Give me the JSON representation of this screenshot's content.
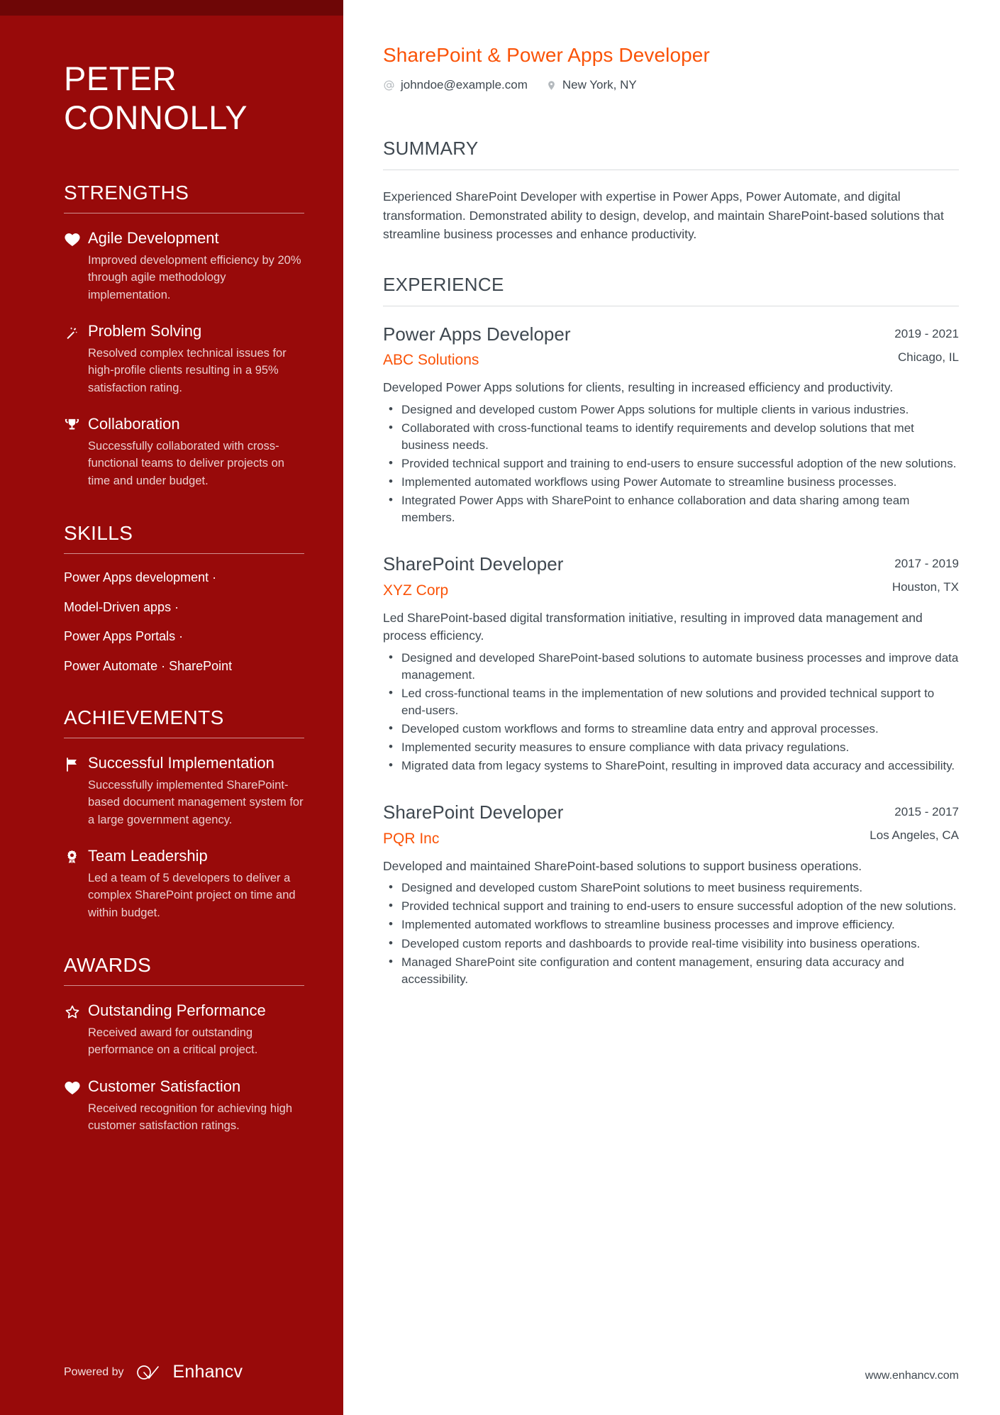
{
  "sidebar": {
    "name": "PETER\nCONNOLLY",
    "name_line1": "PETER",
    "name_line2": "CONNOLLY",
    "sections": [
      {
        "heading": "STRENGTHS",
        "entries": [
          {
            "icon": "heart-icon",
            "title": "Agile Development",
            "desc": "Improved development efficiency by 20% through agile methodology implementation."
          },
          {
            "icon": "magic-wand-icon",
            "title": "Problem Solving",
            "desc": "Resolved complex technical issues for high-profile clients resulting in a 95% satisfaction rating."
          },
          {
            "icon": "trophy-icon",
            "title": "Collaboration",
            "desc": "Successfully collaborated with cross-functional teams to deliver projects on time and under budget."
          }
        ]
      },
      {
        "heading": "ACHIEVEMENTS",
        "entries": [
          {
            "icon": "flag-icon",
            "title": "Successful Implementation",
            "desc": "Successfully implemented SharePoint-based document management system for a large government agency."
          },
          {
            "icon": "award-ribbon-icon",
            "title": "Team Leadership",
            "desc": "Led a team of 5 developers to deliver a complex SharePoint project on time and within budget."
          }
        ]
      },
      {
        "heading": "AWARDS",
        "entries": [
          {
            "icon": "star-icon",
            "title": "Outstanding Performance",
            "desc": "Received award for outstanding performance on a critical project."
          },
          {
            "icon": "heart-icon",
            "title": "Customer Satisfaction",
            "desc": "Received recognition for achieving high customer satisfaction ratings."
          }
        ]
      }
    ],
    "skills": {
      "heading": "SKILLS",
      "lines": [
        "Power Apps development ·",
        "Model-Driven apps ·",
        "Power Apps Portals ·",
        "Power Automate · SharePoint"
      ]
    },
    "footer": {
      "powered_by": "Powered by",
      "brand": "Enhancv"
    }
  },
  "main": {
    "headline": "SharePoint & Power Apps Developer",
    "contact": {
      "email": "johndoe@example.com",
      "email_icon": "at-sign-icon",
      "location": "New York, NY",
      "location_icon": "map-pin-icon"
    },
    "summary": {
      "heading": "SUMMARY",
      "text": "Experienced SharePoint Developer with expertise in Power Apps, Power Automate, and digital transformation. Demonstrated ability to design, develop, and maintain SharePoint-based solutions that streamline business processes and enhance productivity."
    },
    "experience": {
      "heading": "EXPERIENCE",
      "jobs": [
        {
          "role": "Power Apps Developer",
          "company": "ABC Solutions",
          "dates": "2019 - 2021",
          "location": "Chicago, IL",
          "summary": "Developed Power Apps solutions for clients, resulting in increased efficiency and productivity.",
          "bullets": [
            "Designed and developed custom Power Apps solutions for multiple clients in various industries.",
            "Collaborated with cross-functional teams to identify requirements and develop solutions that met business needs.",
            "Provided technical support and training to end-users to ensure successful adoption of the new solutions.",
            "Implemented automated workflows using Power Automate to streamline business processes.",
            "Integrated Power Apps with SharePoint to enhance collaboration and data sharing among team members."
          ]
        },
        {
          "role": "SharePoint Developer",
          "company": "XYZ Corp",
          "dates": "2017 - 2019",
          "location": "Houston, TX",
          "summary": "Led SharePoint-based digital transformation initiative, resulting in improved data management and process efficiency.",
          "bullets": [
            "Designed and developed SharePoint-based solutions to automate business processes and improve data management.",
            "Led cross-functional teams in the implementation of new solutions and provided technical support to end-users.",
            "Developed custom workflows and forms to streamline data entry and approval processes.",
            "Implemented security measures to ensure compliance with data privacy regulations.",
            "Migrated data from legacy systems to SharePoint, resulting in improved data accuracy and accessibility."
          ]
        },
        {
          "role": "SharePoint Developer",
          "company": "PQR Inc",
          "dates": "2015 - 2017",
          "location": "Los Angeles, CA",
          "summary": "Developed and maintained SharePoint-based solutions to support business operations.",
          "bullets": [
            "Designed and developed custom SharePoint solutions to meet business requirements.",
            "Provided technical support and training to end-users to ensure successful adoption of the new solutions.",
            "Implemented automated workflows to streamline business processes and improve efficiency.",
            "Developed custom reports and dashboards to provide real-time visibility into business operations.",
            "Managed SharePoint site configuration and content management, ensuring data accuracy and accessibility."
          ]
        }
      ]
    },
    "footer_url": "www.enhancv.com"
  },
  "colors": {
    "sidebar_bg": "#980a0a",
    "sidebar_strip": "#6e0606",
    "accent_orange": "#fa5308",
    "text_dark": "#3f4850"
  }
}
